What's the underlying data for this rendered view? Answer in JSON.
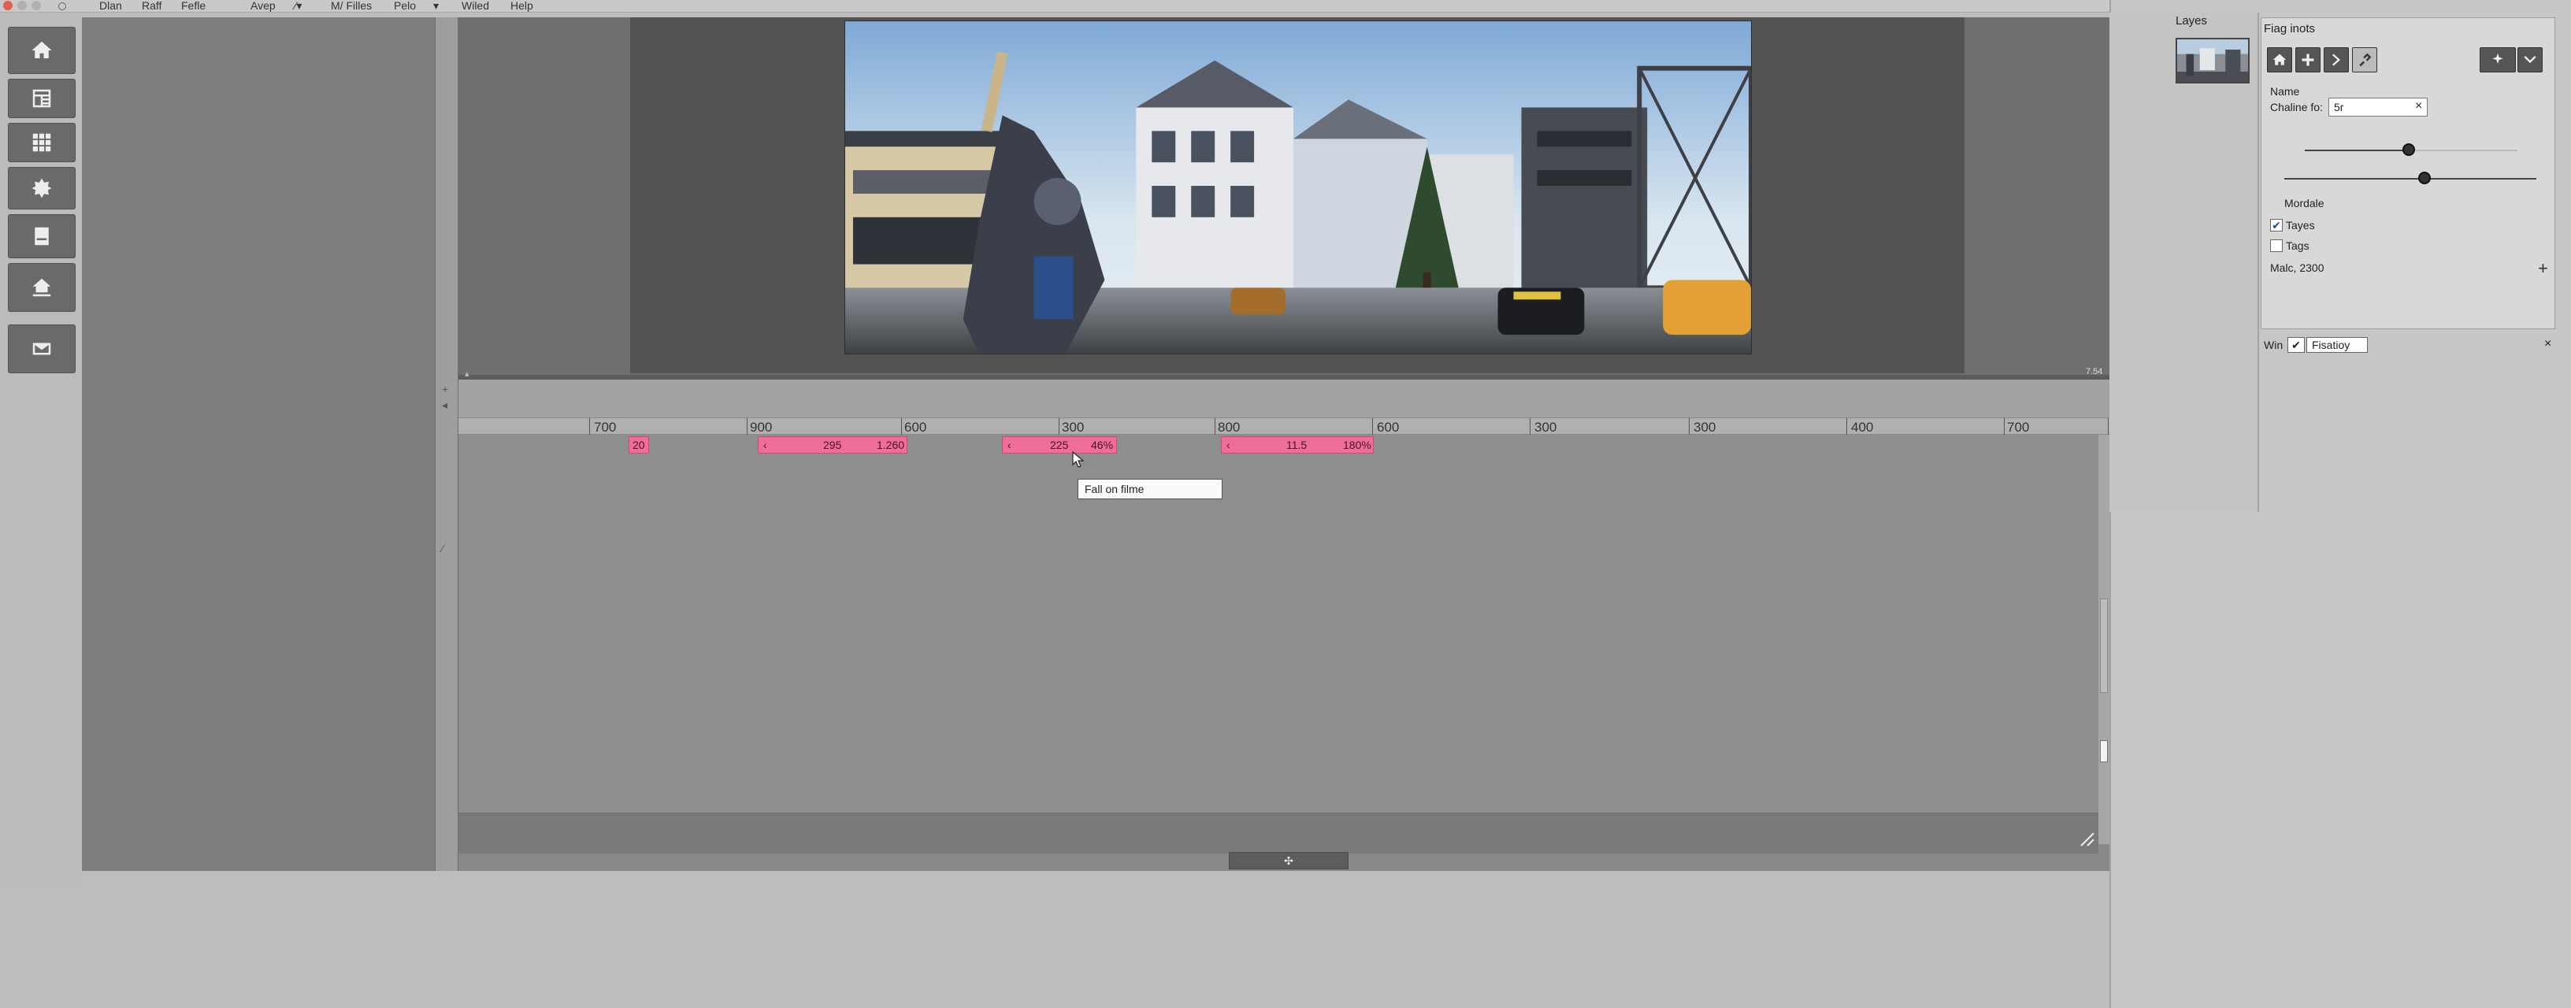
{
  "menubar": {
    "items": [
      "Dlan",
      "Raff",
      "Fefle",
      "Avep",
      "M/ Filles",
      "Pelo",
      "Wiled",
      "Help"
    ]
  },
  "toolbar": {
    "tools": [
      {
        "name": "home-icon"
      },
      {
        "name": "layout-icon"
      },
      {
        "name": "grid-icon"
      },
      {
        "name": "effects-icon"
      },
      {
        "name": "document-icon"
      },
      {
        "name": "import-icon"
      },
      {
        "name": "export-icon"
      }
    ]
  },
  "viewer": {
    "corner_label": "7.54"
  },
  "timeline": {
    "ruler_labels": [
      "700",
      "900",
      "600",
      "300",
      "800",
      "600",
      "300",
      "300",
      "400",
      "700"
    ],
    "clips": [
      {
        "start": "20",
        "end": ""
      },
      {
        "start": "295",
        "end": "1.260"
      },
      {
        "start": "225",
        "end": "46%"
      },
      {
        "start": "11.5",
        "end": "180%"
      }
    ],
    "tooltip": "Fall on filme",
    "scroll_glyph": "✣"
  },
  "right_panel": {
    "layers_title": "Layes",
    "props_title": "Fiag inots",
    "name_label": "Name",
    "chaline_label": "Chaline fo:",
    "chaline_value": "5r",
    "clear_glyph": "×",
    "section_label": "Mordale",
    "checks": [
      {
        "label": "Tayes",
        "checked": true
      },
      {
        "label": "Tags",
        "checked": false
      }
    ],
    "malc_label": "Malc, 2300",
    "add_glyph": "+",
    "win_label": "Win",
    "win_check": "✔",
    "win_value": "Fisatioy",
    "win_close": "×"
  },
  "colors": {
    "clip": "#ee6e99",
    "workspace": "#898989",
    "panel": "#c6c6c6"
  }
}
